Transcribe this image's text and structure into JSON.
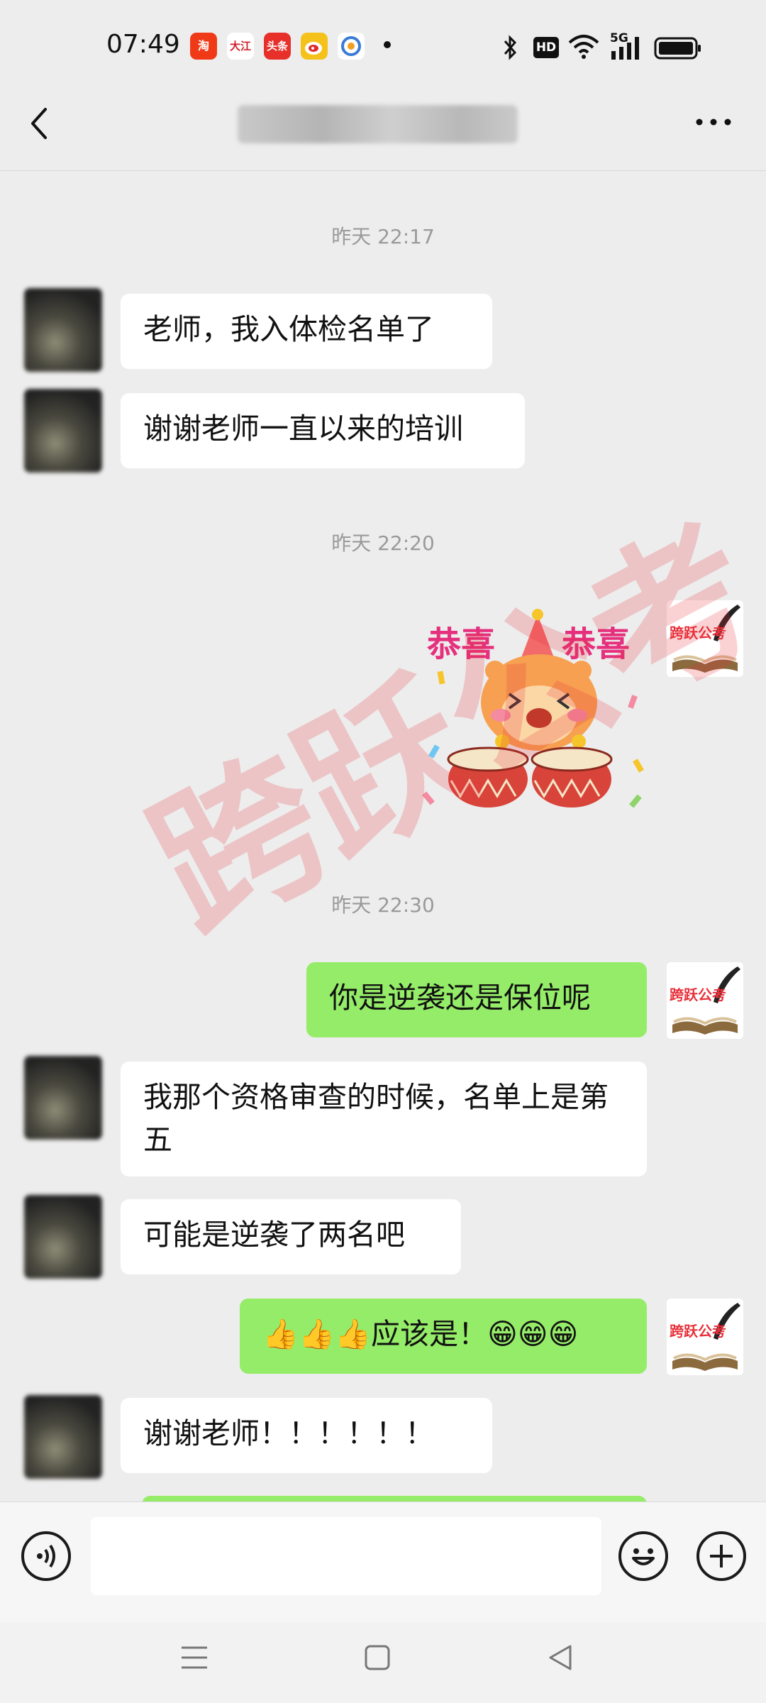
{
  "status_bar": {
    "time": "07:49",
    "apps": [
      {
        "icon": "taobao-icon",
        "label": "淘",
        "color": "#f03a17"
      },
      {
        "icon": "dajiang-icon",
        "label": "大江",
        "color": "#ffffff"
      },
      {
        "icon": "toutiao-icon",
        "label": "头条",
        "color": "#e8302a"
      },
      {
        "icon": "weibo-icon",
        "label": "",
        "color": "#f5a623"
      },
      {
        "icon": "app-globe-icon",
        "label": "",
        "color": "#3a7bd5"
      }
    ],
    "right": [
      "bluetooth-icon",
      "hd-icon",
      "wifi-icon",
      "signal-5g-icon",
      "battery-icon"
    ],
    "hd": "HD",
    "net": "5G"
  },
  "nav": {
    "back_icon": "back-arrow-icon",
    "more_icon": "more-icon"
  },
  "chat": {
    "times": [
      "昨天 22:17",
      "昨天 22:20",
      "昨天 22:30"
    ],
    "messages": [
      {
        "side": "in",
        "text": "老师，我入体检名单了"
      },
      {
        "side": "in",
        "text": "谢谢老师一直以来的培训"
      },
      {
        "side": "out",
        "type": "sticker",
        "text_left": "恭喜",
        "text_right": "恭喜"
      },
      {
        "side": "out",
        "text": "你是逆袭还是保位呢"
      },
      {
        "side": "in",
        "text": "我那个资格审查的时候，名单上是第五"
      },
      {
        "side": "in",
        "text": "可能是逆袭了两名吧"
      },
      {
        "side": "out",
        "text": "👍👍👍应该是！😁😁😁"
      },
      {
        "side": "in",
        "text": "谢谢老师！！！！！！"
      }
    ],
    "self_avatar_text": "跨跃公考",
    "watermark": "跨跃公考",
    "brand_color": "#e8303a",
    "out_bubble_color": "#95ec69"
  },
  "input_bar": {
    "voice_icon": "voice-icon",
    "emoji_icon": "emoji-icon",
    "plus_icon": "plus-icon",
    "placeholder": ""
  },
  "system_nav": [
    "menu-icon",
    "home-icon",
    "back-icon"
  ]
}
